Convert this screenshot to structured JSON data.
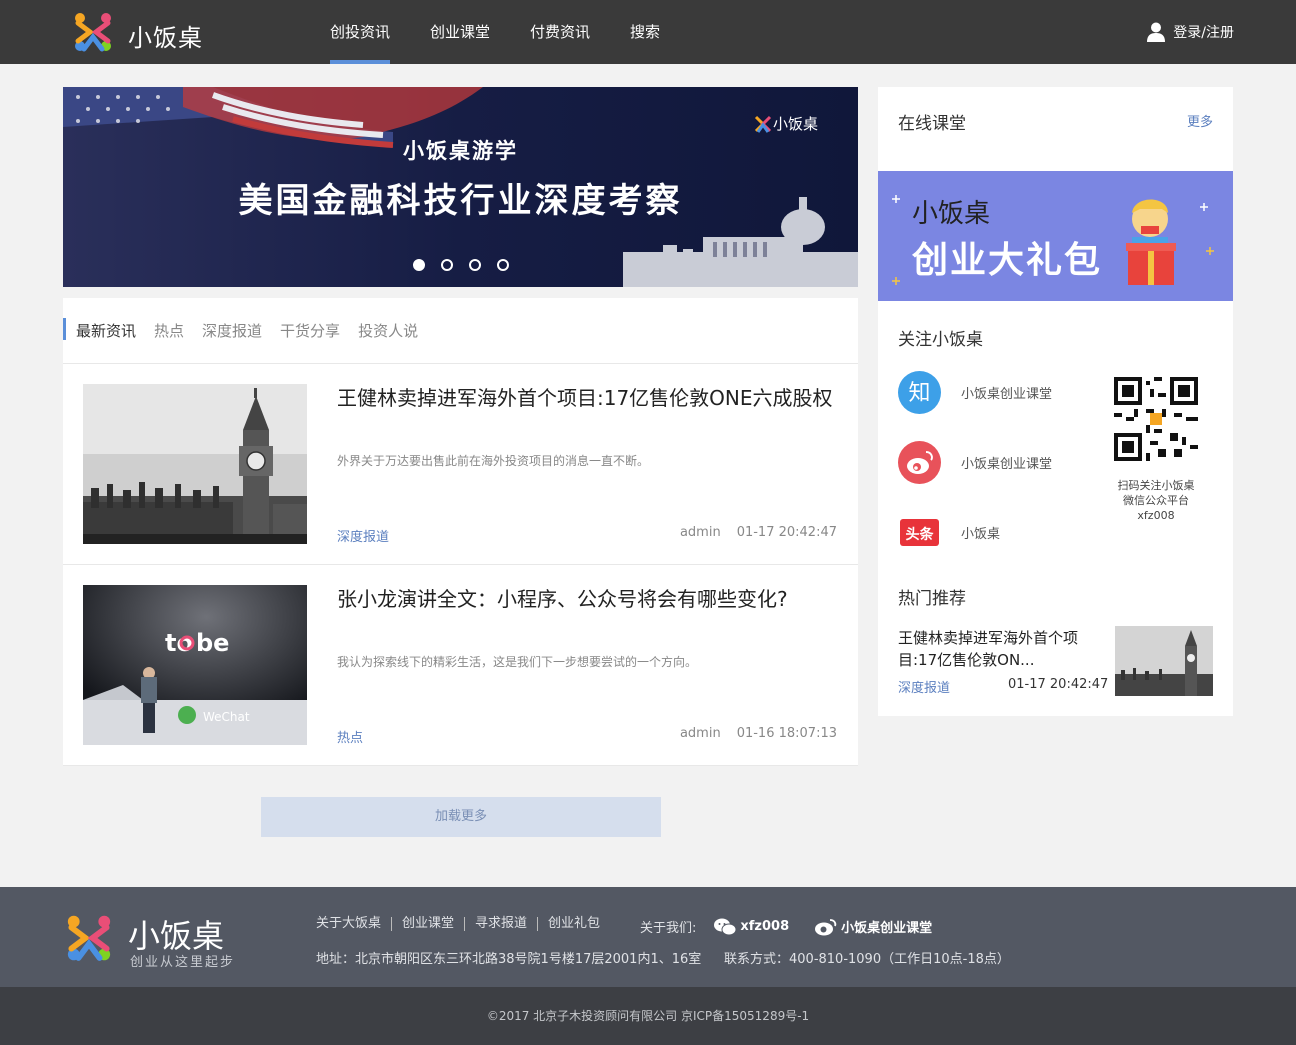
{
  "header": {
    "logo_text": "小饭桌",
    "nav": [
      "创投资讯",
      "创业课堂",
      "付费资讯",
      "搜索"
    ],
    "login_label": "登录/注册"
  },
  "banner": {
    "logo_text": "小饭桌",
    "subtitle": "小饭桌游学",
    "title": "美国金融科技行业深度考察",
    "slide_count": 4,
    "active_slide": 1
  },
  "feed": {
    "tabs": [
      "最新资讯",
      "热点",
      "深度报道",
      "干货分享",
      "投资人说"
    ],
    "articles": [
      {
        "title": "王健林卖掉进军海外首个项目:17亿售伦敦ONE六成股权",
        "desc": "外界关于万达要出售此前在海外投资项目的消息一直不断。",
        "category": "深度报道",
        "author": "admin",
        "time": "01-17 20:42:47"
      },
      {
        "title": "张小龙演讲全文：小程序、公众号将会有哪些变化?",
        "desc": "我认为探索线下的精彩生活，这是我们下一步想要尝试的一个方向。",
        "category": "热点",
        "author": "admin",
        "time": "01-16 18:07:13"
      }
    ],
    "load_more": "加载更多"
  },
  "sidebar": {
    "courses_title": "在线课堂",
    "more": "更多",
    "gift_line1": "小饭桌",
    "gift_line2": "创业大礼包",
    "follow_title": "关注小饭桌",
    "follow_items": [
      {
        "icon": "zhihu-icon",
        "label": "小饭桌创业课堂"
      },
      {
        "icon": "weibo-icon",
        "label": "小饭桌创业课堂"
      },
      {
        "icon": "toutiao-icon",
        "label": "小饭桌"
      }
    ],
    "qr_caption": [
      "扫码关注小饭桌",
      "微信公众平台",
      "xfz008"
    ],
    "hot_title": "热门推荐",
    "hot_item": {
      "title": "王健林卖掉进军海外首个项目:17亿售伦敦ON...",
      "category": "深度报道",
      "time": "01-17 20:42:47"
    }
  },
  "footer": {
    "logo_text": "小饭桌",
    "slogan": "创业从这里起步",
    "links": [
      "关于大饭桌",
      "创业课堂",
      "寻求报道",
      "创业礼包"
    ],
    "about_label": "关于我们:",
    "wechat": "xfz008",
    "weibo": "小饭桌创业课堂",
    "address": "地址：北京市朝阳区东三环北路38号院1号楼17层2001内1、16室",
    "phone": "联系方式：400-810-1090（工作日10点-18点）",
    "copyright": "©2017 北京子木投资顾问有限公司 京ICP备15051289号-1"
  },
  "colors": {
    "header_bg": "#3a3a3a",
    "accent": "#5b8fd9",
    "link": "#5b7fbf",
    "footer_bg": "#535863"
  }
}
